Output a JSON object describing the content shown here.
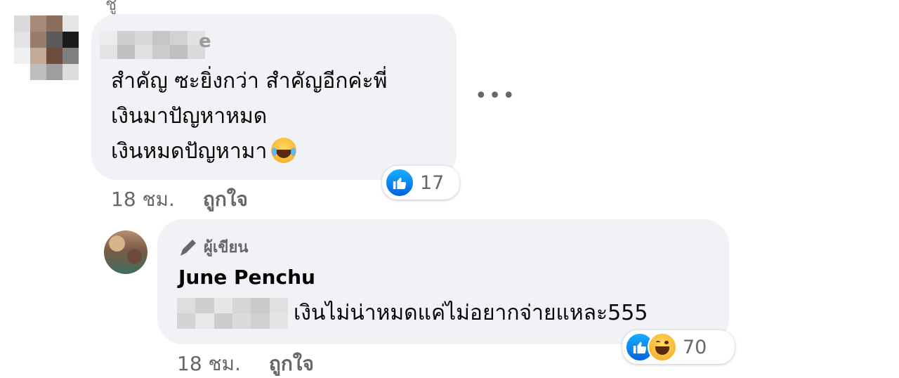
{
  "thread": {
    "top_fragment": "ชู",
    "comment": {
      "author_name_visible": "e",
      "lines": [
        "สำคัญ ซะยิ่งกว่า สำคัญอีกค่ะพี่",
        "เงินมาปัญหาหมด",
        "เงินหมดปัญหามา"
      ],
      "more_label": "•••",
      "reactions": {
        "count": "17",
        "types": [
          "like-icon"
        ]
      },
      "time": "18 ชม.",
      "like_label": "ถูกใจ"
    },
    "reply": {
      "badge": "ผู้เขียน",
      "author": "June Penchu",
      "text": "เงินไม่น่าหมดแค่ไม่อยากจ่ายแหละ555",
      "reactions": {
        "count": "70",
        "types": [
          "like-icon",
          "haha-icon"
        ]
      },
      "time": "18 ชม.",
      "like_label": "ถูกใจ"
    }
  },
  "colors": {
    "bubble_bg": "#f0f2f5",
    "meta_text": "#65676b",
    "like_blue": "#0866ff",
    "text": "#050505"
  }
}
